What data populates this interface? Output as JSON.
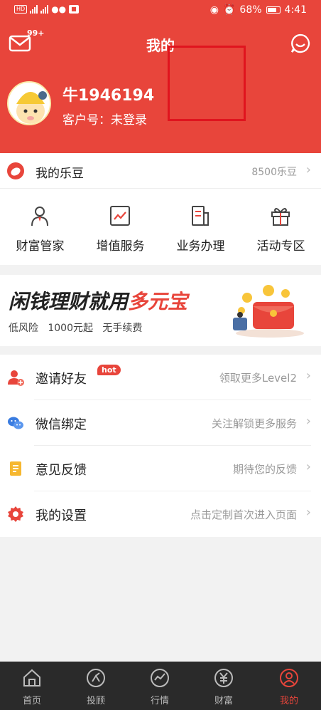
{
  "status_bar": {
    "battery": "68%",
    "time": "4:41"
  },
  "header": {
    "title": "我的",
    "mail_badge": "99+",
    "username": "牛1946194",
    "account_label": "客户号：未登录"
  },
  "ledou": {
    "label": "我的乐豆",
    "value": "8500乐豆"
  },
  "grid": [
    {
      "label": "财富管家",
      "icon": "person-icon"
    },
    {
      "label": "增值服务",
      "icon": "chart-icon"
    },
    {
      "label": "业务办理",
      "icon": "document-icon"
    },
    {
      "label": "活动专区",
      "icon": "gift-icon"
    }
  ],
  "banner": {
    "title_main": "闲钱理财就用",
    "title_highlight": "多元宝",
    "subtitle": "低风险   1000元起   无手续费"
  },
  "list": [
    {
      "label": "邀请好友",
      "hint": "领取更多Level2",
      "badge": "hot",
      "icon": "invite-icon"
    },
    {
      "label": "微信绑定",
      "hint": "关注解锁更多服务",
      "icon": "wechat-icon"
    },
    {
      "label": "意见反馈",
      "hint": "期待您的反馈",
      "icon": "feedback-icon"
    },
    {
      "label": "我的设置",
      "hint": "点击定制首次进入页面",
      "icon": "settings-icon"
    }
  ],
  "nav": [
    {
      "label": "首页",
      "icon": "home-icon"
    },
    {
      "label": "投顾",
      "icon": "advisor-icon"
    },
    {
      "label": "行情",
      "icon": "market-icon"
    },
    {
      "label": "财富",
      "icon": "wealth-icon"
    },
    {
      "label": "我的",
      "icon": "profile-icon",
      "active": true
    }
  ],
  "colors": {
    "brand_red": "#e8453b",
    "highlight_box": "#e0141e",
    "nav_bg": "#2a2a2a"
  }
}
